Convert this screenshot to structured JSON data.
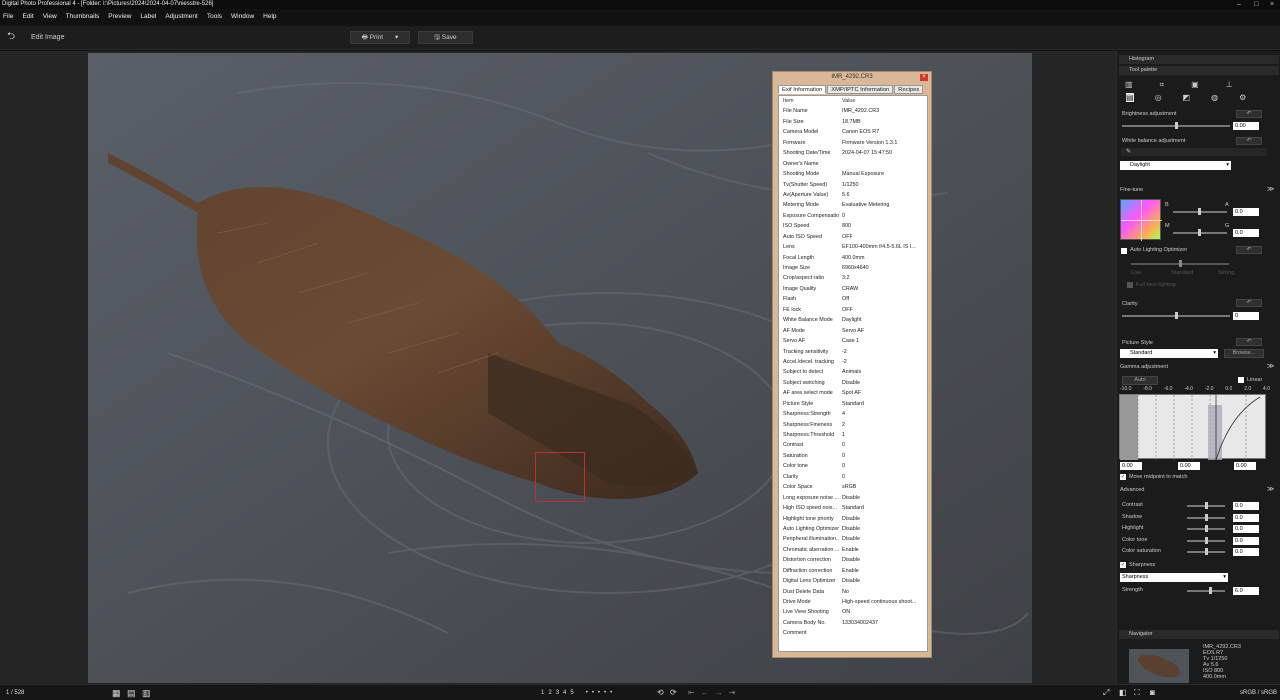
{
  "window": {
    "title": "Digital Photo Professional 4 - [Folder: I:\\Pictures\\2024\\2024-04-07\\niesstre-526]"
  },
  "menu": [
    "File",
    "Edit",
    "View",
    "Thumbnails",
    "Preview",
    "Label",
    "Adjustment",
    "Tools",
    "Window",
    "Help"
  ],
  "toolbar": {
    "edit_image": "Edit Image",
    "print": "Print",
    "save": "Save"
  },
  "dialog": {
    "title": "IMR_4292.CR3",
    "tabs": [
      "Exif Information",
      "XMP/IPTC Information",
      "Recipes"
    ],
    "col_item": "Item",
    "col_value": "Value",
    "rows": [
      [
        "File Name",
        "IMR_4292.CR3"
      ],
      [
        "File Size",
        "18.7MB"
      ],
      [
        "Camera Model",
        "Canon EOS R7"
      ],
      [
        "Firmware",
        "Firmware Version 1.3.1"
      ],
      [
        "Shooting Date/Time",
        "2024-04-07 15:47:50"
      ],
      [
        "Owner's Name",
        ""
      ],
      [
        "Shooting Mode",
        "Manual Exposure"
      ],
      [
        "Tv(Shutter Speed)",
        "1/1250"
      ],
      [
        "Av(Aperture Value)",
        "5.6"
      ],
      [
        "Metering Mode",
        "Evaluative Metering"
      ],
      [
        "Exposure Compensatio...",
        "0"
      ],
      [
        "ISO Speed",
        "800"
      ],
      [
        "Auto ISO Speed",
        "OFF"
      ],
      [
        "Lens",
        "EF100-400mm f/4.5-5.6L IS I..."
      ],
      [
        "Focal Length",
        "400.0mm"
      ],
      [
        "Image Size",
        "6960x4640"
      ],
      [
        "Crop/aspect ratio",
        "3:2"
      ],
      [
        "Image Quality",
        "CRAW"
      ],
      [
        "Flash",
        "Off"
      ],
      [
        "FE lock",
        "OFF"
      ],
      [
        "White Balance Mode",
        "Daylight"
      ],
      [
        "AF Mode",
        "Servo AF"
      ],
      [
        "Servo AF",
        "Case 1"
      ],
      [
        "Tracking sensitivity",
        "-2"
      ],
      [
        "Accel./decel. tracking",
        "-2"
      ],
      [
        "Subject to detect",
        "Animals"
      ],
      [
        "Subject switching",
        "Disable"
      ],
      [
        "AF area select mode",
        "Spot AF"
      ],
      [
        "Picture Style",
        "Standard"
      ],
      [
        "Sharpness:Strength",
        "4"
      ],
      [
        "Sharpness:Fineness",
        "2"
      ],
      [
        "Sharpness:Threshold",
        "1"
      ],
      [
        "Contrast",
        "0"
      ],
      [
        "Saturation",
        "0"
      ],
      [
        "Color tone",
        "0"
      ],
      [
        "Clarity",
        "0"
      ],
      [
        "Color Space",
        "sRGB"
      ],
      [
        "Long exposure noise ...",
        "Disable"
      ],
      [
        "High ISO speed nois...",
        "Standard"
      ],
      [
        "Highlight tone priority",
        "Disable"
      ],
      [
        "Auto Lighting Optimizer",
        "Disable"
      ],
      [
        "Peripheral illumination...",
        "Disable"
      ],
      [
        "Chromatic aberration ...",
        "Enable"
      ],
      [
        "Distortion correction",
        "Disable"
      ],
      [
        "Diffraction correction",
        "Enable"
      ],
      [
        "Digital Lens Optimizer",
        "Disable"
      ],
      [
        "Dust Delete Data",
        "No"
      ],
      [
        "Drive Mode",
        "High-speed continuous shoot..."
      ],
      [
        "Live View Shooting",
        "ON"
      ],
      [
        "Camera Body No.",
        "133034002437"
      ],
      [
        "Comment",
        ""
      ]
    ]
  },
  "panel": {
    "histogram": "Histogram",
    "tool_palette": "Tool palette",
    "brightness": "Brightness adjustment",
    "brightness_val": "0.00",
    "white_balance": "White balance adjustment",
    "wb_select": "Daylight",
    "fine_tune": "Fine-tune",
    "ft_b": "B",
    "ft_a": "A",
    "ft_m": "M",
    "ft_g": "G",
    "ft_val1": "0.0",
    "ft_val2": "0.0",
    "alo": "Auto Lighting Optimizer",
    "alo_low": "Low",
    "alo_std": "Standard",
    "alo_strong": "Strong",
    "alo_face": "Full face lighting",
    "clarity": "Clarity",
    "clarity_val": "0",
    "picture_style": "Picture Style",
    "ps_select": "Standard",
    "browse": "Browse...",
    "gamma": "Gamma adjustment",
    "auto": "Auto",
    "linear": "Linear",
    "gamma_ticks": [
      "-10.0",
      "-8.0",
      "-6.0",
      "-4.0",
      "-2.0",
      "0.0",
      "2.0",
      "4.0"
    ],
    "gamma_vals": [
      "0.00",
      "0.00",
      "0.00"
    ],
    "midpoint": "Move midpoint to match",
    "advanced": "Advanced",
    "adv_labels": [
      "Contrast",
      "Shadow",
      "Highlight",
      "Color tone",
      "Color saturation"
    ],
    "adv_vals": [
      "0.0",
      "0.0",
      "0.0",
      "0.0",
      "0.0"
    ],
    "sharpness": "Sharpness",
    "sharp_select": "Sharpness",
    "strength": "Strength",
    "strength_val": "6.0",
    "navigator": "Navigator",
    "nav_info": [
      "IMR_4292.CR3",
      "EOS R7",
      "Tv 1/1250",
      "Av 5.6",
      "ISO 800",
      "400.0mm"
    ]
  },
  "status": {
    "count": "1 / 528",
    "colorspace": "sRGB / sRGB",
    "ratings": [
      "1",
      "2",
      "3",
      "4",
      "5"
    ]
  }
}
